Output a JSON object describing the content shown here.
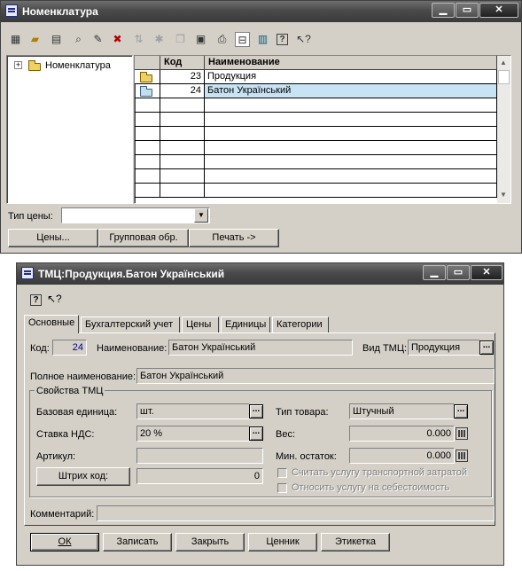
{
  "top_window": {
    "title": "Номенклатура",
    "toolbar_icons": [
      "new-item-icon",
      "new-folder-icon",
      "copy-icon",
      "find-icon",
      "edit-icon",
      "delete-icon",
      "move-icon",
      "mark-icon",
      "copy-disabled-icon",
      "properties-icon",
      "print-icon",
      "hierarchy-icon",
      "list-icon",
      "help-icon",
      "context-help-icon"
    ],
    "tree_root": "Номенклатура",
    "columns": {
      "code": "Код",
      "name": "Наименование"
    },
    "rows": [
      {
        "code": "23",
        "name": "Продукция",
        "type": "folder"
      },
      {
        "code": "24",
        "name": "Батон Український",
        "type": "folder-open",
        "selected": true
      }
    ],
    "price_type_label": "Тип цены:",
    "price_type_value": "",
    "buttons": {
      "prices": "Цены...",
      "group": "Групповая обр.",
      "print": "Печать ->"
    }
  },
  "dialog": {
    "title": "ТМЦ:Продукция.Батон Український",
    "tabs": [
      "Основные",
      "Бухгалтерский учет",
      "Цены",
      "Единицы",
      "Категории"
    ],
    "code_label": "Код:",
    "code_value": "24",
    "name_label": "Наименование:",
    "name_value": "Батон Український",
    "kind_label": "Вид ТМЦ:",
    "kind_value": "Продукция",
    "full_name_label": "Полное наименование:",
    "full_name_value": "Батон Український",
    "group_title": "Свойства ТМЦ",
    "base_unit_label": "Базовая единица:",
    "base_unit_value": "шт.",
    "vat_label": "Ставка НДС:",
    "vat_value": "20 %",
    "article_label": "Артикул:",
    "article_value": "",
    "barcode_button": "Штрих код:",
    "barcode_value": "0",
    "goods_type_label": "Тип товара:",
    "goods_type_value": "Штучный",
    "weight_label": "Вес:",
    "weight_value": "0.000",
    "min_stock_label": "Мин. остаток:",
    "min_stock_value": "0.000",
    "check1_label": "Считать услугу транспортной затратой",
    "check2_label": "Относить услугу на себестоимость",
    "comment_label": "Комментарий:",
    "comment_value": "",
    "buttons": {
      "ok": "ОК",
      "save": "Записать",
      "close": "Закрыть",
      "price_tag": "Ценник",
      "label": "Этикетка"
    }
  }
}
